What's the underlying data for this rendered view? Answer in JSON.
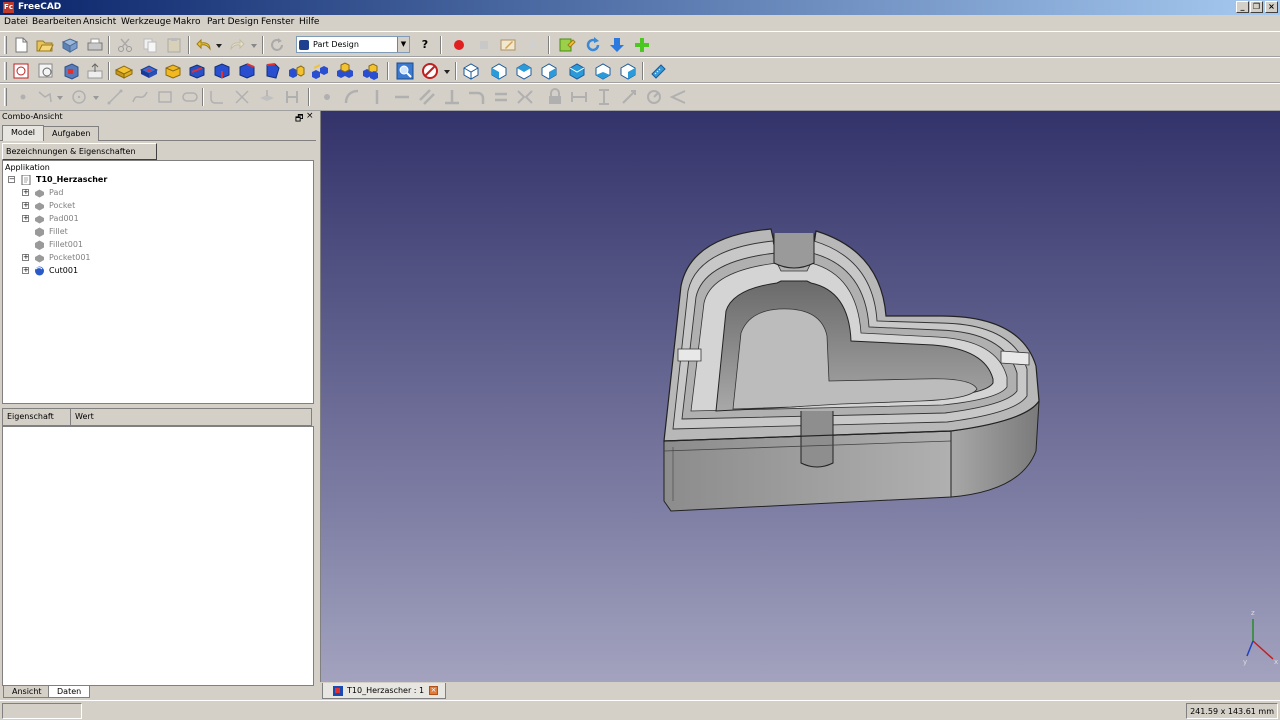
{
  "window": {
    "title": "FreeCAD",
    "app_icon_text": "Fc",
    "minimize": "_",
    "restore": "❐",
    "close": "×"
  },
  "menu": [
    "Datei",
    "Bearbeiten",
    "Ansicht",
    "Werkzeuge",
    "Makro",
    "Part Design",
    "Fenster",
    "Hilfe"
  ],
  "toolbar": {
    "workbench": "Part Design",
    "whats_this": "?"
  },
  "combo": {
    "title": "Combo-Ansicht",
    "float_icon": "🗗",
    "close_icon": "×",
    "tabs": [
      "Model",
      "Aufgaben"
    ],
    "section_button": "Bezeichnungen & Eigenschaften",
    "tree_root": "Applikation",
    "document": "T10_Herzascher",
    "items": [
      {
        "label": "Pad",
        "expandable": true,
        "visible": false
      },
      {
        "label": "Pocket",
        "expandable": true,
        "visible": false
      },
      {
        "label": "Pad001",
        "expandable": true,
        "visible": false
      },
      {
        "label": "Fillet",
        "expandable": false,
        "visible": false
      },
      {
        "label": "Fillet001",
        "expandable": false,
        "visible": false
      },
      {
        "label": "Pocket001",
        "expandable": true,
        "visible": false
      },
      {
        "label": "Cut001",
        "expandable": true,
        "visible": true
      }
    ],
    "expander_plus": "+",
    "expander_minus": "−",
    "property_columns": [
      "Eigenschaft",
      "Wert"
    ],
    "bottom_tabs": [
      "Ansicht",
      "Daten"
    ]
  },
  "view": {
    "axis_labels": [
      "z",
      "y",
      "x"
    ],
    "colors": {
      "bg_top": "#33336b",
      "bg_bottom": "#a3a3bf",
      "model": "#a9a9a9"
    }
  },
  "doc_tab": {
    "label": "T10_Herzascher : 1",
    "close": "×"
  },
  "status": {
    "dimensions": "241.59 x 143.61 mm"
  }
}
